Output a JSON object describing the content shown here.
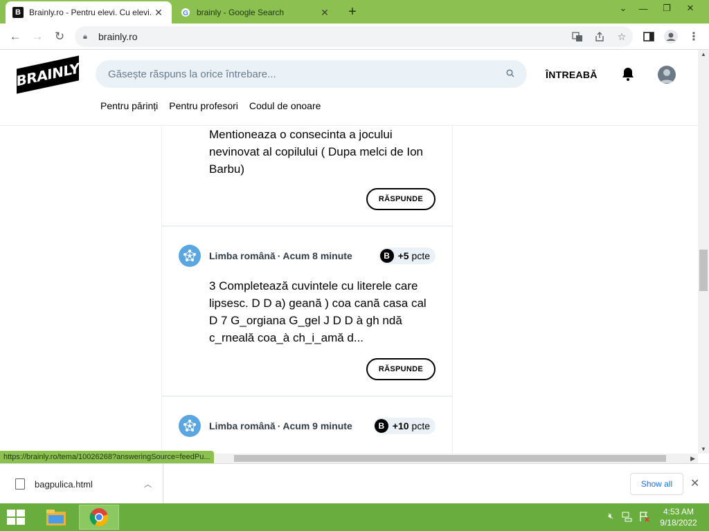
{
  "browser": {
    "tabs": [
      {
        "title": "Brainly.ro - Pentru elevi. Cu elevi.",
        "favicon": "brainly-favicon",
        "active": true
      },
      {
        "title": "brainly - Google Search",
        "favicon": "google-favicon",
        "active": false
      }
    ],
    "url": "brainly.ro",
    "status_url": "https://brainly.ro/tema/10026268?answeringSource=feedPu..."
  },
  "header": {
    "logo": "BRAINLY",
    "search_placeholder": "Găsește răspuns la orice întrebare...",
    "ask_label": "ÎNTREABĂ",
    "nav": [
      "Pentru părinți",
      "Pentru profesori",
      "Codul de onoare"
    ]
  },
  "feed": {
    "answer_label": "RĂSPUNDE",
    "questions": [
      {
        "text": "Mentioneaza o consecinta a jocului nevinovat al copilului ( Dupa melci de Ion Barbu)"
      },
      {
        "subject": "Limba română",
        "time": "Acum 8 minute",
        "points": "+5",
        "points_unit": "pcte",
        "text": "3 Completează cuvintele cu literele care lipsesc. D D a) geană ) coa cană casa cal D 7 G_orgiana G_gel J D D à gh ndă c_rneală coa_à ch_i_amă d..."
      },
      {
        "subject": "Limba română",
        "time": "Acum 9 minute",
        "points": "+10",
        "points_unit": "pcte"
      }
    ]
  },
  "downloads": {
    "file": "bagpulica.html",
    "show_all": "Show all"
  },
  "taskbar": {
    "time": "4:53 AM",
    "date": "9/18/2022"
  },
  "colors": {
    "chrome_frame": "#8cc152",
    "taskbar": "#6aad3f",
    "search_bg": "#ebf2f7",
    "subject_icon": "#5aa6e0"
  }
}
